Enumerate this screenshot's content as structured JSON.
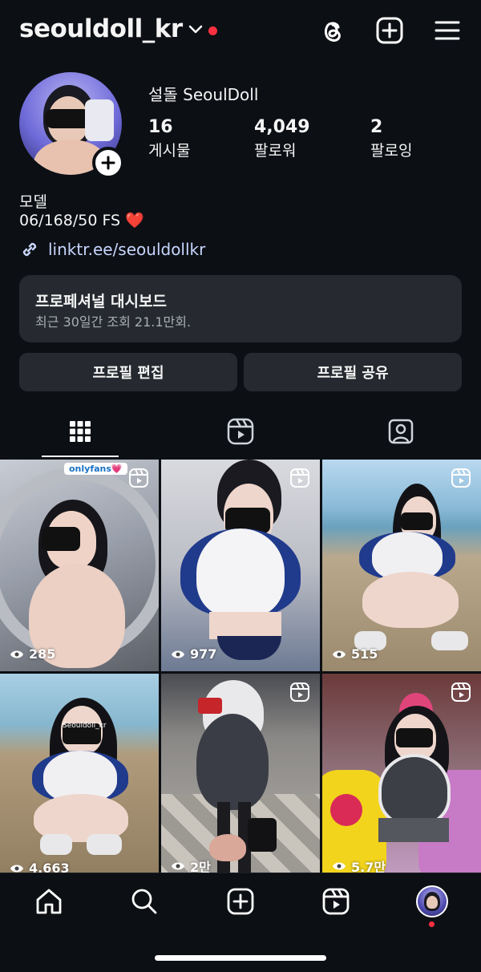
{
  "header": {
    "username": "seouldoll_kr",
    "icons": {
      "threads": "threads-icon",
      "create": "plus-square-icon",
      "menu": "hamburger-menu-icon"
    }
  },
  "profile": {
    "display_name": "설돌 SeoulDoll",
    "stats": [
      {
        "value": "16",
        "label": "게시물"
      },
      {
        "value": "4,049",
        "label": "팔로워"
      },
      {
        "value": "2",
        "label": "팔로잉"
      }
    ],
    "bio_line1": "모델",
    "bio_line2": "06/168/50 FS ❤️",
    "link": "linktr.ee/seouldollkr"
  },
  "dashboard": {
    "title": "프로페셔널 대시보드",
    "subtitle": "최근 30일간 조회 21.1만회."
  },
  "buttons": {
    "edit": "프로필 편집",
    "share": "프로필 공유"
  },
  "tabs": [
    "grid-icon",
    "reels-icon",
    "tagged-icon"
  ],
  "grid": [
    {
      "views": "285",
      "badge": "onlyfans💗"
    },
    {
      "views": "977"
    },
    {
      "views": "515"
    },
    {
      "views": "4,663",
      "badge": "Seouldoll_kr"
    },
    {
      "views": "2만"
    },
    {
      "views": "5.7만"
    }
  ],
  "bottom_nav": [
    "home-icon",
    "search-icon",
    "create-icon",
    "reels-icon",
    "profile-avatar"
  ],
  "colors": {
    "background": "#0c0f14",
    "surface": "#262a30",
    "notification": "#ff3040",
    "link": "#c8d6ff"
  }
}
